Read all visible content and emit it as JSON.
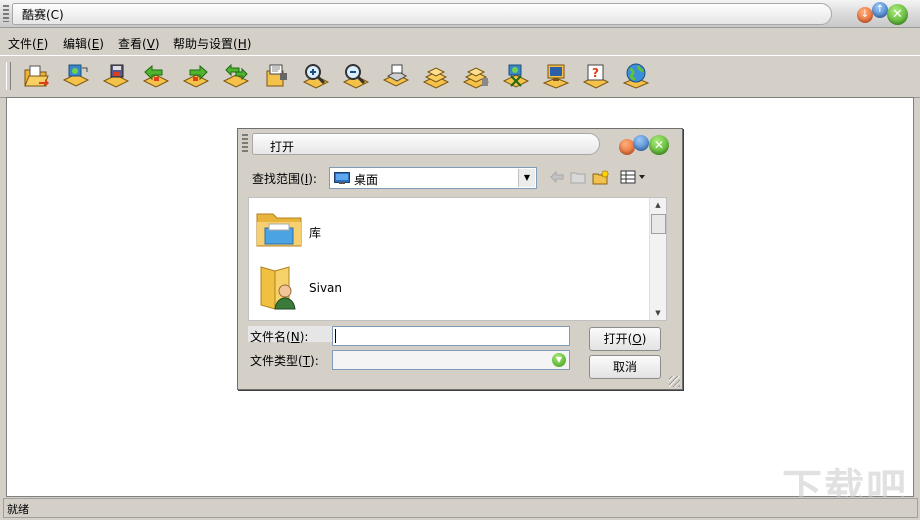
{
  "window": {
    "title": "酷赛(C)"
  },
  "menubar": {
    "items": [
      {
        "label": "文件(",
        "accel": "F",
        "tail": ")"
      },
      {
        "label": "编辑(",
        "accel": "E",
        "tail": ")"
      },
      {
        "label": "查看(",
        "accel": "V",
        "tail": ")"
      },
      {
        "label": "帮助与设置(",
        "accel": "H",
        "tail": ")"
      }
    ]
  },
  "toolbar": {
    "icons": [
      "open-folder-icon",
      "export-icon",
      "save-disk-icon",
      "back-icon",
      "forward-icon",
      "sync-icon",
      "print-icon",
      "zoom-in-icon",
      "zoom-out-icon",
      "printer-icon",
      "stack-icon",
      "stack-add-icon",
      "connect-icon",
      "monitor-icon",
      "help-icon",
      "globe-icon"
    ]
  },
  "statusbar": {
    "text": "就绪"
  },
  "watermark": {
    "text": "下载吧"
  },
  "open_dialog": {
    "title": "打开",
    "look_in_label": "查找范围",
    "look_in_accel": "I",
    "look_in_value": "桌面",
    "files": [
      {
        "name": "库",
        "icon": "library-folder-icon"
      },
      {
        "name": "Sivan",
        "icon": "user-folder-icon"
      }
    ],
    "filename_label": "文件名",
    "filename_accel": "N",
    "filename_value": "",
    "filetype_label": "文件类型",
    "filetype_accel": "T",
    "filetype_value": "",
    "open_button": "打开(",
    "open_accel": "O",
    "open_tail": ")",
    "cancel_button": "取消"
  }
}
